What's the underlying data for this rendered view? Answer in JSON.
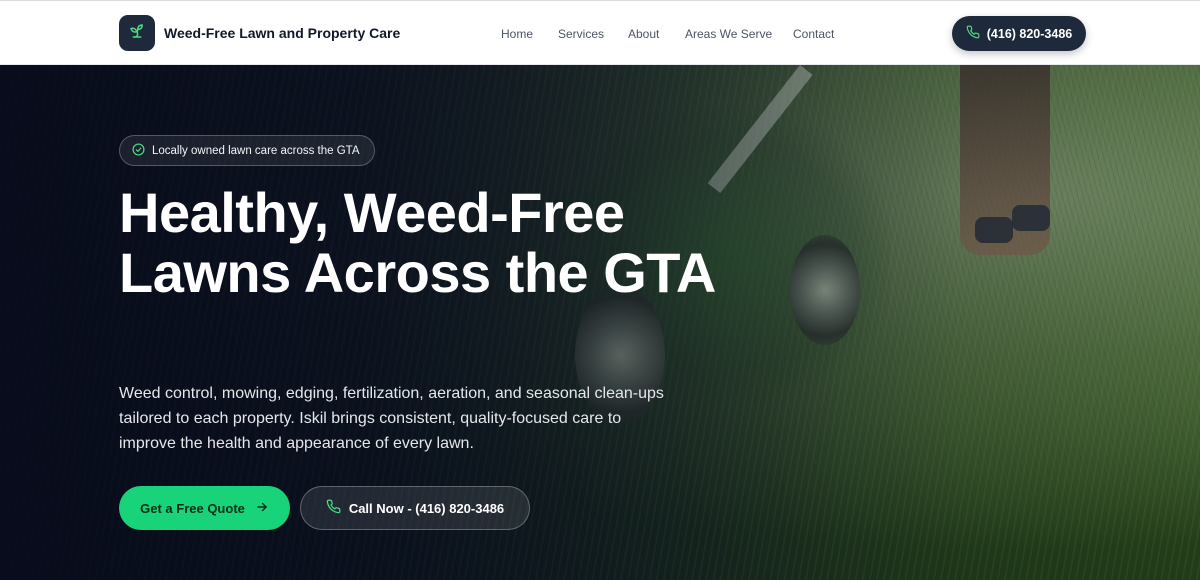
{
  "header": {
    "brand": "Weed-Free Lawn and Property Care",
    "logo_icon": "sprout-icon",
    "nav": [
      "Home",
      "Services",
      "About",
      "Areas We Serve",
      "Contact"
    ],
    "phone": "(416) 820-3486",
    "phone_icon": "phone-icon"
  },
  "hero": {
    "badge": "Locally owned lawn care across the GTA",
    "badge_icon": "check-circle-icon",
    "headline": "Healthy, Weed-Free Lawns Across the GTA",
    "subtext": "Weed control, mowing, edging, fertilization, aeration, and seasonal clean-ups tailored to each property. Iskil brings consistent, quality-focused care to improve the health and appearance of every lawn.",
    "primary_cta": "Get a Free Quote",
    "secondary_cta": "Call Now - (416) 820-3486"
  },
  "colors": {
    "header_bg": "#ffffff",
    "dark_pill": "#1e293b",
    "accent_green": "#19d37a",
    "hero_text": "#ffffff"
  }
}
